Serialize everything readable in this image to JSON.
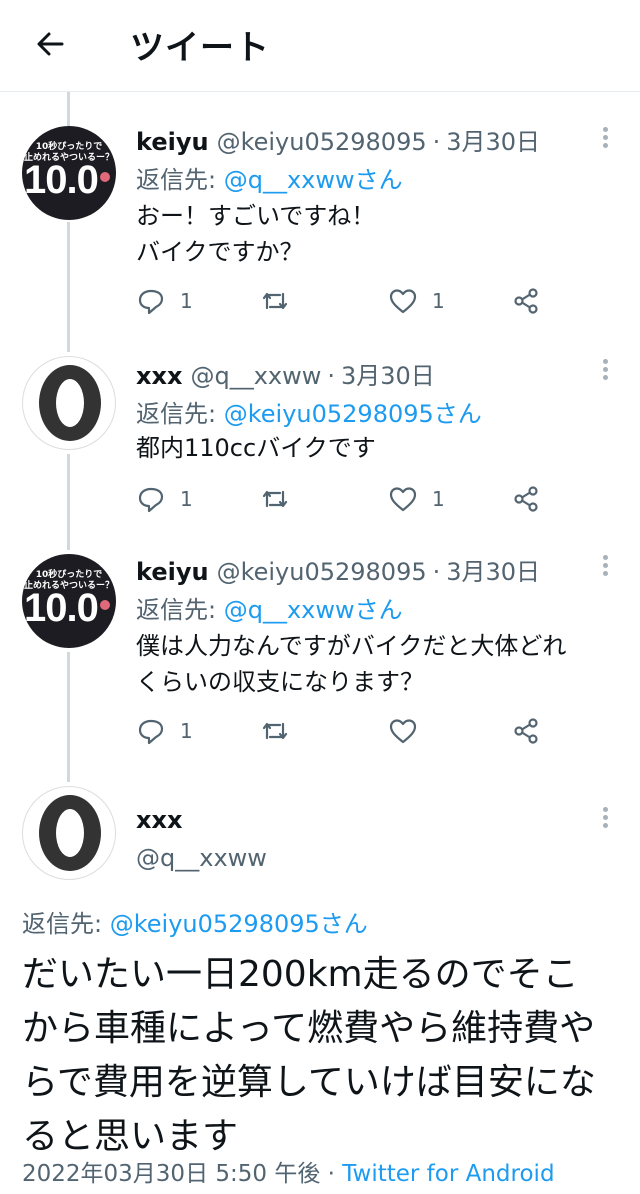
{
  "header": {
    "title": "ツイート"
  },
  "replies": [
    {
      "name": "keiyu",
      "handle": "@keiyu05298095",
      "sep": "·",
      "date": "3月30日",
      "replying_prefix": "返信先: ",
      "replying_to": "@q__xxwwさん",
      "text_lines": [
        "おー！すごいですね！",
        "バイクですか？"
      ],
      "reply_count": "1",
      "like_count": "1",
      "avatar": {
        "top_text": "10秒ぴったりで\n止めれるやついるー？",
        "big_text": "10.0"
      }
    },
    {
      "name": "xxx",
      "handle": "@q__xxww",
      "sep": "·",
      "date": "3月30日",
      "replying_prefix": "返信先: ",
      "replying_to": "@keiyu05298095さん",
      "text_lines": [
        "都内110ccバイクです"
      ],
      "reply_count": "1",
      "like_count": "1"
    },
    {
      "name": "keiyu",
      "handle": "@keiyu05298095",
      "sep": "·",
      "date": "3月30日",
      "replying_prefix": "返信先: ",
      "replying_to": "@q__xxwwさん",
      "text_lines": [
        "僕は人力なんですがバイクだと大体どれ",
        "くらいの収支になります？"
      ],
      "reply_count": "1",
      "like_count": "",
      "avatar": {
        "top_text": "10秒ぴったりで\n止めれるやついるー？",
        "big_text": "10.0"
      }
    }
  ],
  "main_tweet": {
    "name": "xxx",
    "handle": "@q__xxww",
    "replying_prefix": "返信先: ",
    "replying_to": "@keiyu05298095さん",
    "text_lines": [
      "だいたい一日200km走るのでそこ",
      "から車種によって燃費やら維持費や",
      "らで費用を逆算していけば目安にな",
      "ると思います"
    ],
    "datetime": "2022年03月30日 5:50 午後",
    "sep": " · ",
    "via": "Twitter for Android"
  },
  "colors": {
    "accent": "#1d9bf0",
    "secondary_text": "#536471",
    "thread_line": "#cfd9de"
  },
  "icons": [
    "back-arrow-icon",
    "more-vertical-icon",
    "reply-icon",
    "retweet-icon",
    "like-icon",
    "share-icon"
  ]
}
